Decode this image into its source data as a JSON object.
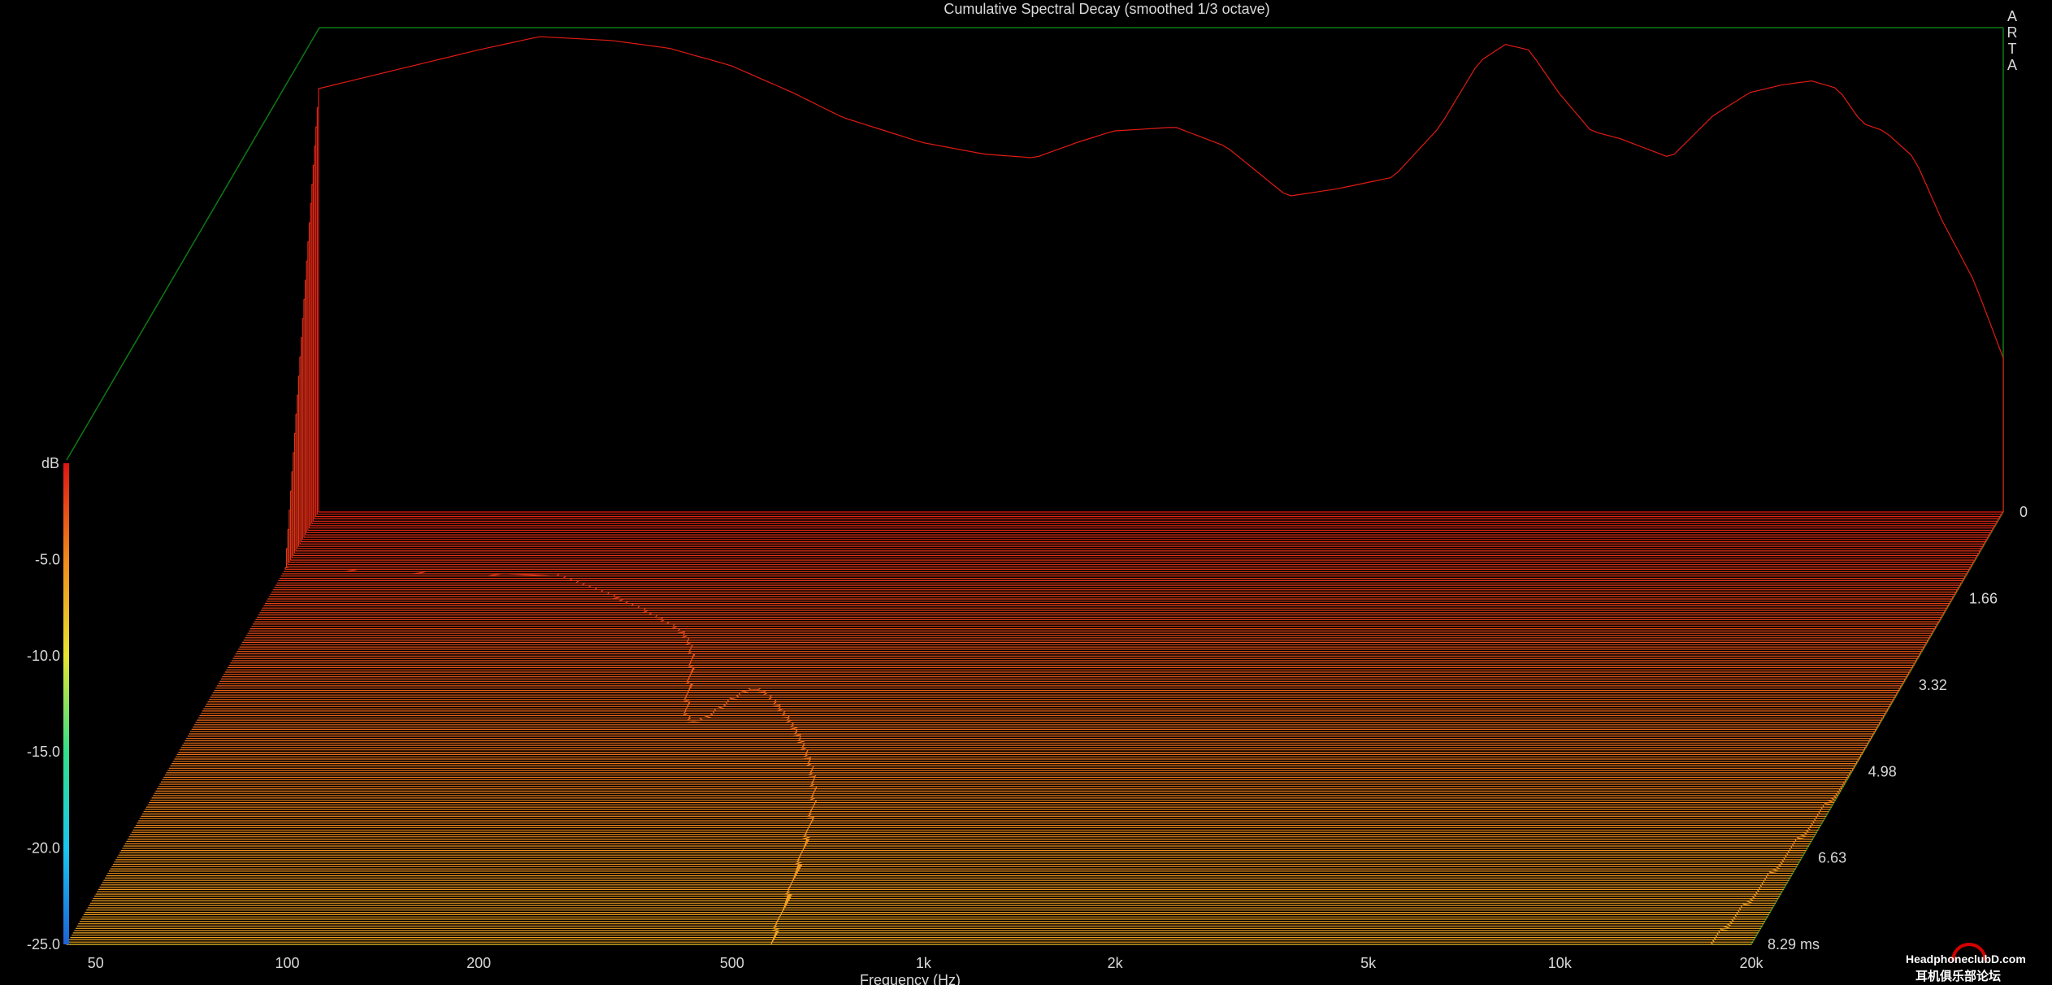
{
  "chart_data": {
    "type": "area",
    "title": "Cumulative Spectral Decay (smoothed 1/3 octave)",
    "xlabel": "Frequency (Hz)",
    "ylabel": "dB",
    "zlabel": "ms",
    "software_label": "ARTA",
    "x_ticks": [
      "50",
      "100",
      "200",
      "500",
      "1k",
      "2k",
      "5k",
      "10k",
      "20k"
    ],
    "x_tick_values": [
      50,
      100,
      200,
      500,
      1000,
      2000,
      5000,
      10000,
      20000
    ],
    "xlim": [
      45,
      20000
    ],
    "ylim": [
      -25,
      0
    ],
    "y_ticks": [
      "-5.0",
      "-10.0",
      "-15.0",
      "-20.0",
      "-25.0"
    ],
    "y_tick_values": [
      -5,
      -10,
      -15,
      -20,
      -25
    ],
    "time_ticks": [
      "0",
      "1.66",
      "3.32",
      "4.98",
      "6.63",
      "8.29 ms"
    ],
    "time_tick_values": [
      0,
      1.66,
      3.32,
      4.98,
      6.63,
      8.29
    ],
    "tlim": [
      0,
      8.29
    ],
    "slice_count": 190,
    "x_scale": "log",
    "colormap": [
      "#1e62d6",
      "#19c6f0",
      "#32e08a",
      "#e8e430",
      "#f08a1c",
      "#e01414"
    ],
    "initial_response": {
      "freq_hz": [
        45,
        60,
        80,
        100,
        130,
        160,
        200,
        250,
        300,
        400,
        500,
        600,
        700,
        800,
        1000,
        1200,
        1500,
        1800,
        2200,
        2600,
        3000,
        3300,
        3600,
        4000,
        4500,
        5000,
        6000,
        7000,
        8000,
        9000,
        10000,
        11000,
        12000,
        13000,
        14500,
        16000,
        18000,
        20000
      ],
      "level_db": [
        -3.0,
        -2.0,
        -1.0,
        -0.3,
        -0.5,
        -0.9,
        -1.8,
        -3.2,
        -4.5,
        -5.8,
        -6.4,
        -6.6,
        -5.8,
        -5.2,
        -5.0,
        -6.0,
        -8.6,
        -8.2,
        -7.6,
        -5.0,
        -1.6,
        -0.7,
        -1.0,
        -3.2,
        -5.2,
        -5.6,
        -6.6,
        -4.4,
        -3.2,
        -2.8,
        -2.6,
        -3.0,
        -4.8,
        -5.2,
        -6.6,
        -9.8,
        -13.0,
        -17.0
      ]
    }
  }
}
